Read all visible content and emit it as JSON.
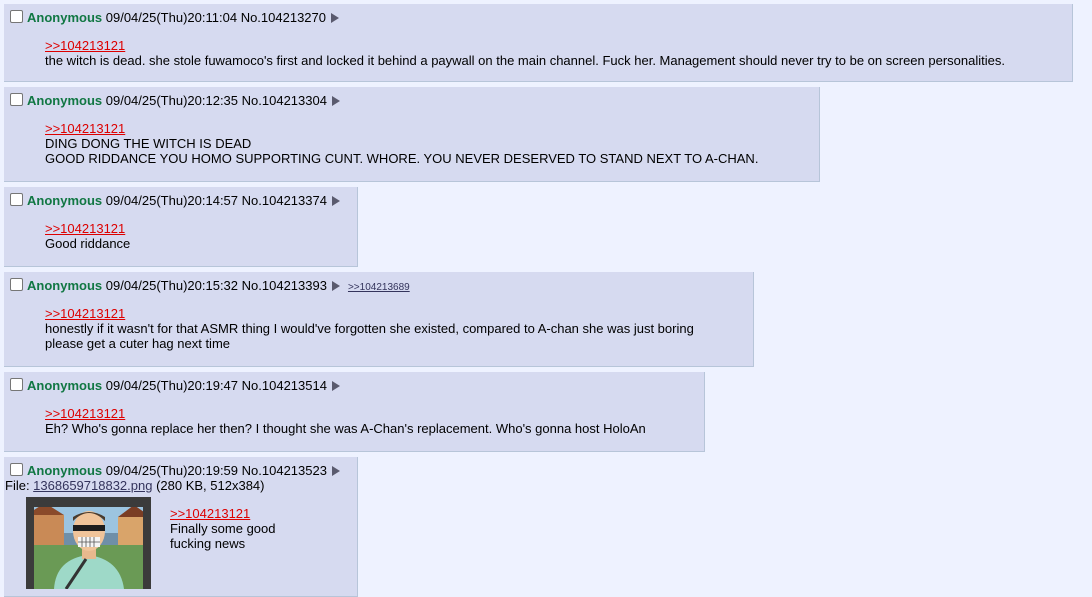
{
  "posts": [
    {
      "name": "Anonymous",
      "date": "09/04/25(Thu)20:11:04",
      "num": "No.104213270",
      "quote": ">>104213121",
      "lines": [
        "the witch is dead. she stole fuwamoco's first and locked it behind a paywall on the main channel. Fuck her. Management should never try to be on screen personalities."
      ]
    },
    {
      "name": "Anonymous",
      "date": "09/04/25(Thu)20:12:35",
      "num": "No.104213304",
      "quote": ">>104213121",
      "lines": [
        "DING DONG THE WITCH IS DEAD",
        "GOOD RIDDANCE YOU HOMO SUPPORTING CUNT. WHORE. YOU NEVER DESERVED TO STAND NEXT TO A-CHAN."
      ]
    },
    {
      "name": "Anonymous",
      "date": "09/04/25(Thu)20:14:57",
      "num": "No.104213374",
      "quote": ">>104213121",
      "lines": [
        "Good riddance"
      ]
    },
    {
      "name": "Anonymous",
      "date": "09/04/25(Thu)20:15:32",
      "num": "No.104213393",
      "backlink": ">>104213689",
      "quote": ">>104213121",
      "lines": [
        "honestly if it wasn't for that ASMR thing I would've forgotten she existed, compared to A-chan she was just boring",
        "please get a cuter hag next time"
      ]
    },
    {
      "name": "Anonymous",
      "date": "09/04/25(Thu)20:19:47",
      "num": "No.104213514",
      "quote": ">>104213121",
      "lines": [
        "Eh? Who's gonna replace her then? I thought she was A-Chan's replacement. Who's gonna host HoloAn"
      ]
    },
    {
      "name": "Anonymous",
      "date": "09/04/25(Thu)20:19:59",
      "num": "No.104213523",
      "file_label": "File: ",
      "file_name": "1368659718832.png",
      "file_meta": " (280 KB, 512x384)",
      "quote": ">>104213121",
      "lines": [
        "Finally some good",
        "fucking news"
      ]
    }
  ]
}
